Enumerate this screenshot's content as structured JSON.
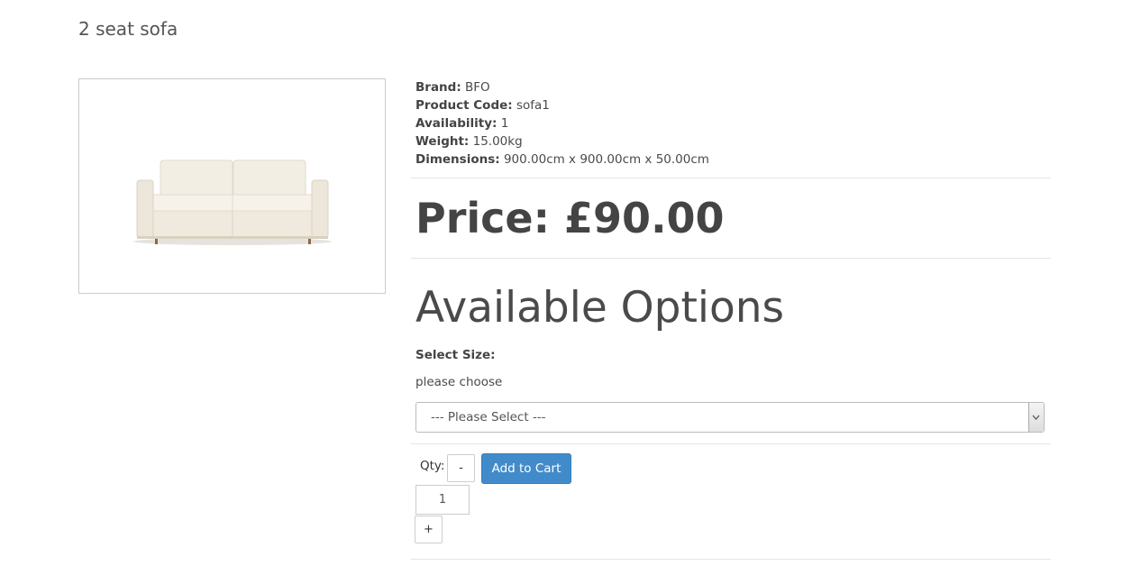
{
  "product": {
    "title": "2 seat sofa",
    "image_alt": "sofa-image"
  },
  "details": {
    "brand_label": "Brand:",
    "brand_value": "BFO",
    "code_label": "Product Code:",
    "code_value": "sofa1",
    "availability_label": "Availability:",
    "availability_value": "1",
    "weight_label": "Weight:",
    "weight_value": "15.00kg",
    "dimensions_label": "Dimensions:",
    "dimensions_value": "900.00cm x 900.00cm x 50.00cm"
  },
  "price": {
    "text": "Price: £90.00"
  },
  "options": {
    "heading": "Available Options",
    "size_label": "Select Size:",
    "size_help": "please choose",
    "select_value": "--- Please Select ---"
  },
  "cart": {
    "qty_label": "Qty:",
    "minus_label": "-",
    "qty_value": "1",
    "plus_label": "+",
    "add_label": "Add to Cart"
  },
  "colors": {
    "accent": "#428bca",
    "text": "#4a4a4a"
  }
}
